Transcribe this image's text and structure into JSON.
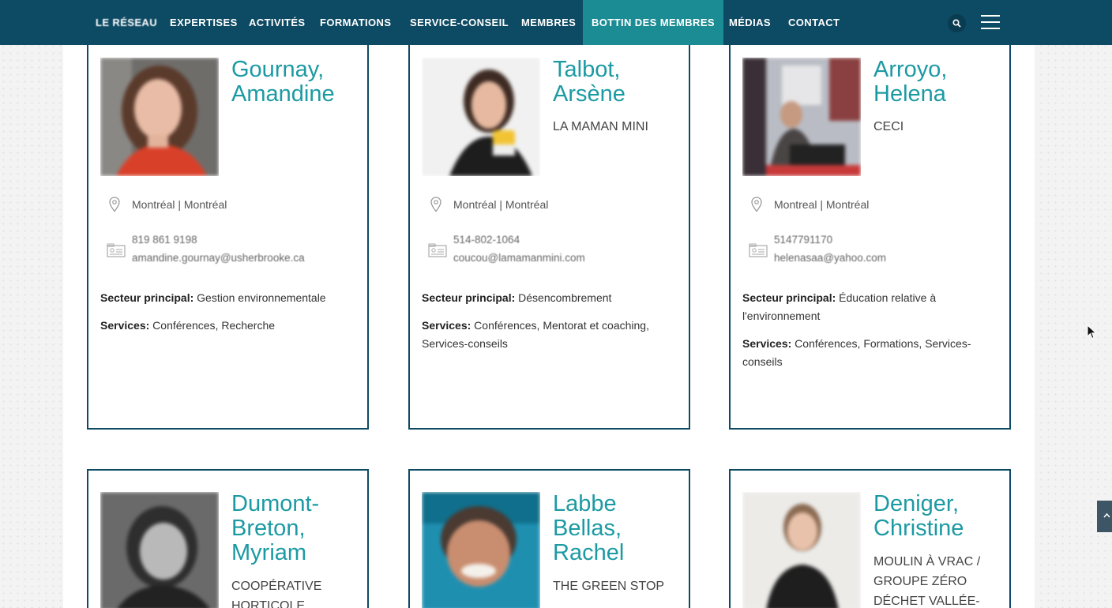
{
  "nav": {
    "items": [
      "LE RÉSEAU",
      "EXPERTISES",
      "ACTIVITÉS",
      "FORMATIONS",
      "SERVICE-CONSEIL",
      "MEMBRES",
      "BOTTIN DES MEMBRES",
      "MÉDIAS",
      "CONTACT"
    ],
    "active_index": 6,
    "search_icon": "search-icon",
    "menu_icon": "hamburger-menu-icon"
  },
  "labels": {
    "sector": "Secteur principal:",
    "services": "Services:"
  },
  "members": [
    {
      "name_line1": "Gournay,",
      "name_line2": "Amandine",
      "name_line3": "",
      "org": "",
      "location": "Montréal | Montréal",
      "phone": "819 861 9198",
      "email": "amandine.gournay@usherbrooke.ca",
      "sector": "Gestion environnementale",
      "services": "Conférences, Recherche"
    },
    {
      "name_line1": "Talbot,",
      "name_line2": "Arsène",
      "name_line3": "",
      "org": "LA MAMAN MINI",
      "location": "Montréal | Montréal",
      "phone": "514-802-1064",
      "email": "coucou@lamamanmini.com",
      "sector": "Désencombrement",
      "services": "Conférences, Mentorat et coaching, Services-conseils"
    },
    {
      "name_line1": "Arroyo,",
      "name_line2": "Helena",
      "name_line3": "",
      "org": "CECI",
      "location": "Montreal | Montréal",
      "phone": "5147791170",
      "email": "helenasaa@yahoo.com",
      "sector": "Éducation relative à l'environnement",
      "services": "Conférences, Formations, Services-conseils"
    },
    {
      "name_line1": "Dumont-",
      "name_line2": "Breton,",
      "name_line3": "Myriam",
      "org": "COOPÉRATIVE HORTICOLE",
      "location": "",
      "phone": "",
      "email": "",
      "sector": "",
      "services": ""
    },
    {
      "name_line1": "Labbe",
      "name_line2": "Bellas,",
      "name_line3": "Rachel",
      "org": "THE GREEN STOP",
      "location": "",
      "phone": "",
      "email": "",
      "sector": "",
      "services": ""
    },
    {
      "name_line1": "Deniger,",
      "name_line2": "Christine",
      "name_line3": "",
      "org": "MOULIN À VRAC / GROUPE ZÉRO DÉCHET VALLÉE-DU-",
      "location": "",
      "phone": "",
      "email": "",
      "sector": "",
      "services": ""
    }
  ],
  "icons": {
    "location": "map-pin-icon",
    "contact": "contact-card-icon",
    "scroll_top": "chevron-up-icon",
    "cursor": "mouse-cursor-icon"
  },
  "colors": {
    "nav_bg": "#0d4a63",
    "nav_active": "#1c8c94",
    "name": "#1c9aa3",
    "card_border": "#0d4a63"
  }
}
